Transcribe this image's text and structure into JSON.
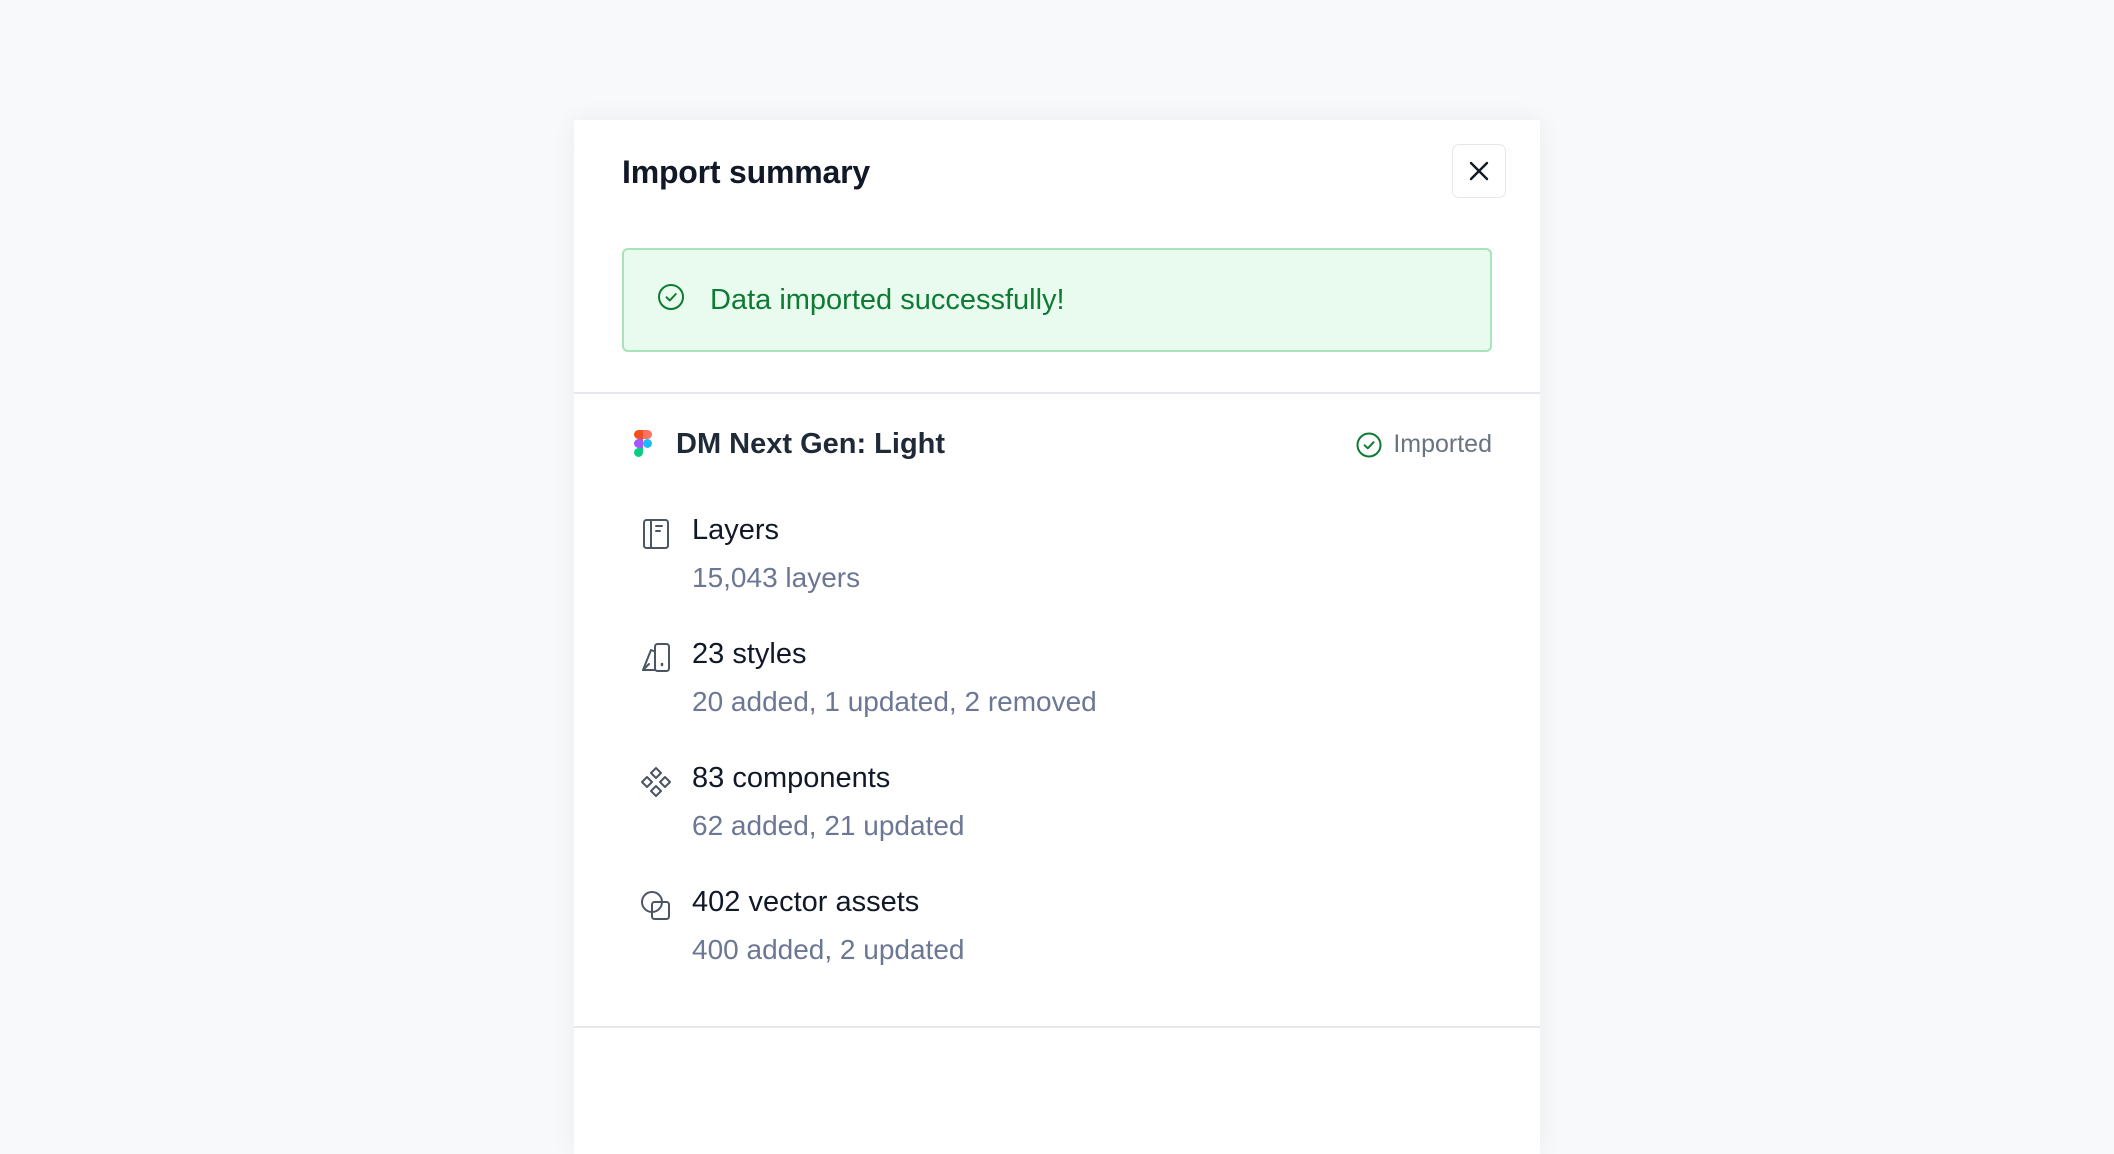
{
  "modal": {
    "title": "Import summary",
    "close_icon": "close-icon"
  },
  "alert": {
    "icon": "check-circle-icon",
    "message": "Data imported successfully!",
    "color": "#0f7a34",
    "background": "#e8fbee"
  },
  "source": {
    "icon": "figma-icon",
    "name": "DM Next Gen: Light",
    "status_icon": "check-circle-icon",
    "status": "Imported"
  },
  "items": [
    {
      "icon": "layers-icon",
      "title": "Layers",
      "subtitle": "15,043 layers"
    },
    {
      "icon": "styles-icon",
      "title": "23 styles",
      "subtitle": "20 added, 1 updated, 2 removed"
    },
    {
      "icon": "components-icon",
      "title": "83 components",
      "subtitle": "62 added, 21 updated"
    },
    {
      "icon": "vector-assets-icon",
      "title": "402 vector assets",
      "subtitle": "400 added, 2 updated"
    }
  ]
}
